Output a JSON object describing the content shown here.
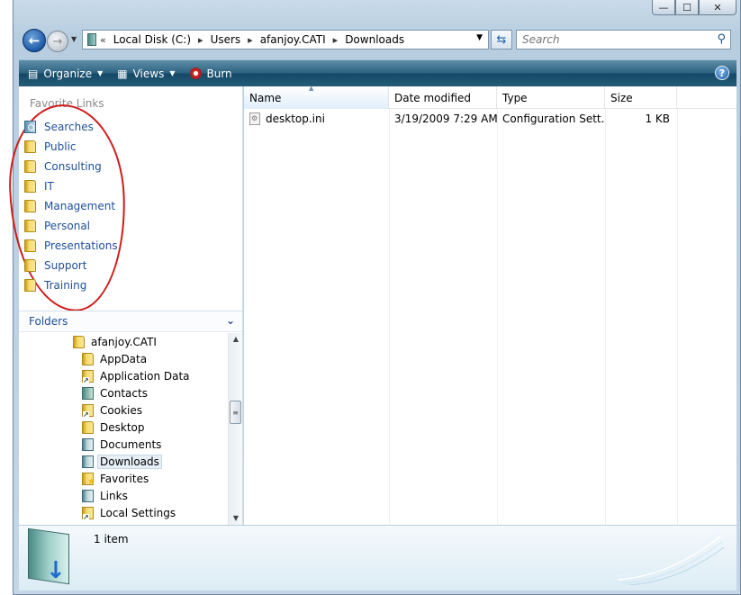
{
  "titlebar": {
    "minimize_glyph": "—",
    "maximize_glyph": "☐",
    "close_glyph": "✕"
  },
  "address": {
    "separator": "«",
    "parts": [
      "Local Disk (C:)",
      "Users",
      "afanjoy.CATI",
      "Downloads"
    ],
    "chevron": "▸"
  },
  "search": {
    "placeholder": "Search"
  },
  "toolbar": {
    "organize_label": "Organize",
    "views_label": "Views",
    "burn_label": "Burn",
    "help_glyph": "?"
  },
  "favorites": {
    "header": "Favorite Links",
    "items": [
      {
        "label": "Searches",
        "icon": "search-folder-icon"
      },
      {
        "label": "Public",
        "icon": "folder-icon"
      },
      {
        "label": "Consulting",
        "icon": "folder-icon"
      },
      {
        "label": "IT",
        "icon": "folder-icon"
      },
      {
        "label": "Management",
        "icon": "folder-icon"
      },
      {
        "label": "Personal",
        "icon": "folder-icon"
      },
      {
        "label": "Presentations",
        "icon": "folder-icon"
      },
      {
        "label": "Support",
        "icon": "folder-icon"
      },
      {
        "label": "Training",
        "icon": "folder-icon"
      }
    ]
  },
  "folders": {
    "header": "Folders",
    "tree": [
      {
        "label": "afanjoy.CATI",
        "icon": "folder-icon",
        "level": 0
      },
      {
        "label": "AppData",
        "icon": "folder-icon",
        "level": 1
      },
      {
        "label": "Application Data",
        "icon": "shortcut-icon",
        "level": 1
      },
      {
        "label": "Contacts",
        "icon": "contacts-icon",
        "level": 1
      },
      {
        "label": "Cookies",
        "icon": "shortcut-icon",
        "level": 1
      },
      {
        "label": "Desktop",
        "icon": "folder-icon",
        "level": 1
      },
      {
        "label": "Documents",
        "icon": "doc-icon",
        "level": 1
      },
      {
        "label": "Downloads",
        "icon": "doc-icon",
        "level": 1,
        "selected": true
      },
      {
        "label": "Favorites",
        "icon": "fav-star-icon",
        "level": 1
      },
      {
        "label": "Links",
        "icon": "doc-icon",
        "level": 1
      },
      {
        "label": "Local Settings",
        "icon": "shortcut-icon",
        "level": 1
      }
    ]
  },
  "columns": {
    "name": "Name",
    "date": "Date modified",
    "type": "Type",
    "size": "Size"
  },
  "files": [
    {
      "name": "desktop.ini",
      "date": "3/19/2009 7:29 AM",
      "type": "Configuration Sett...",
      "size": "1 KB"
    }
  ],
  "details": {
    "status": "1 item"
  },
  "colors": {
    "accent_blue": "#1f4f9a",
    "toolbar_dark": "#144a67",
    "annotation_red": "#d11a1a"
  }
}
